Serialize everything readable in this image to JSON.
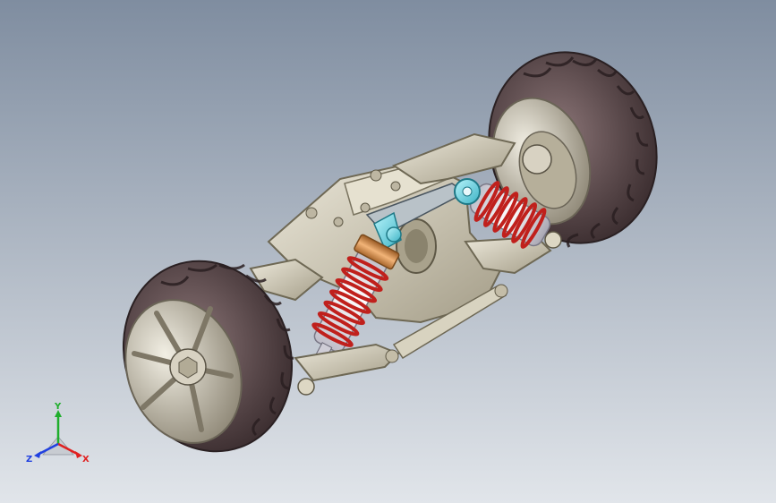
{
  "viewport": {
    "background_top": "#7f8da0",
    "background_bottom": "#e1e5ea"
  },
  "model": {
    "tire_color": "#5e4a4c",
    "rim_color": "#c9c2ae",
    "chassis_color": "#d4cfbc",
    "spring_color": "#c0201c",
    "linkage_color": "#6fd8e6",
    "damper_body_color": "#e9e7ee",
    "collar_color": "#d8924a"
  },
  "triad": {
    "x_label": "X",
    "y_label": "Y",
    "z_label": "Z",
    "x_color": "#e02020",
    "y_color": "#1fae2c",
    "z_color": "#2040e0"
  }
}
